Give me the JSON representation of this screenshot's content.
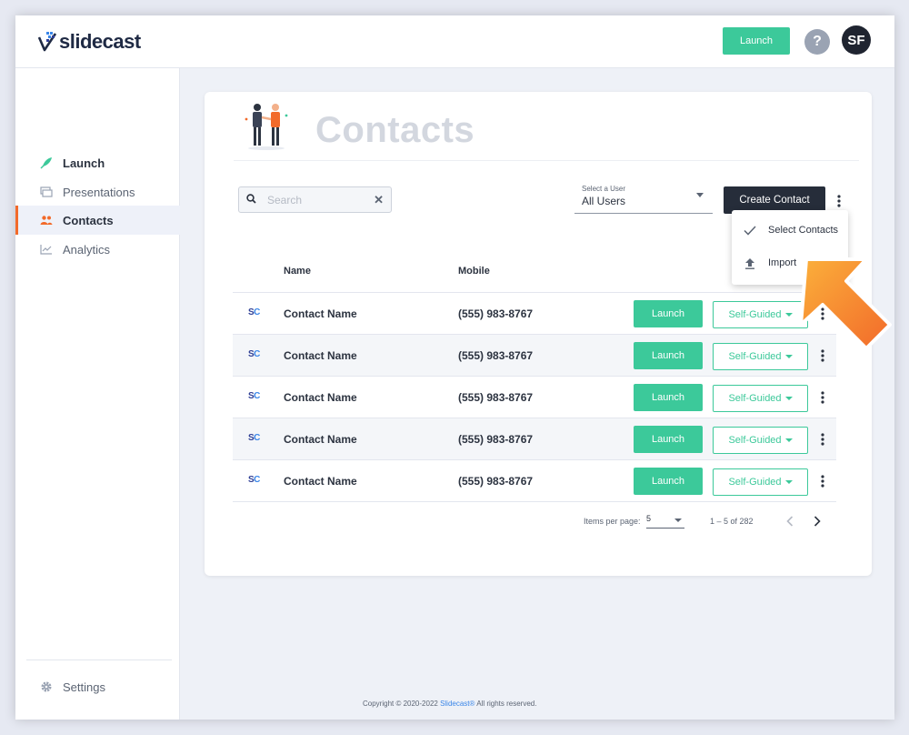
{
  "header": {
    "logo_text": "slidecast",
    "launch_label": "Launch",
    "help_label": "?",
    "avatar_initials": "SF"
  },
  "sidebar": {
    "items": [
      {
        "label": "Launch",
        "icon": "rocket-icon"
      },
      {
        "label": "Presentations",
        "icon": "slides-icon"
      },
      {
        "label": "Contacts",
        "icon": "people-icon"
      },
      {
        "label": "Analytics",
        "icon": "chart-icon"
      }
    ],
    "settings_label": "Settings"
  },
  "page": {
    "title": "Contacts"
  },
  "toolbar": {
    "search_placeholder": "Search",
    "user_select_label": "Select a User",
    "user_select_value": "All Users",
    "create_contact_label": "Create Contact"
  },
  "menu": {
    "items": [
      {
        "label": "Select Contacts",
        "icon": "check-icon"
      },
      {
        "label": "Import",
        "icon": "upload-icon"
      }
    ]
  },
  "table": {
    "columns": [
      "Name",
      "Mobile"
    ],
    "rows": [
      {
        "logo": "SC",
        "name": "Contact Name",
        "mobile": "(555) 983-8767",
        "launch": "Launch",
        "mode": "Self-Guided"
      },
      {
        "logo": "SC",
        "name": "Contact Name",
        "mobile": "(555) 983-8767",
        "launch": "Launch",
        "mode": "Self-Guided"
      },
      {
        "logo": "SC",
        "name": "Contact Name",
        "mobile": "(555) 983-8767",
        "launch": "Launch",
        "mode": "Self-Guided"
      },
      {
        "logo": "SC",
        "name": "Contact Name",
        "mobile": "(555) 983-8767",
        "launch": "Launch",
        "mode": "Self-Guided"
      },
      {
        "logo": "SC",
        "name": "Contact Name",
        "mobile": "(555) 983-8767",
        "launch": "Launch",
        "mode": "Self-Guided"
      }
    ]
  },
  "pagination": {
    "items_per_page_label": "Items per page:",
    "items_per_page_value": "5",
    "range_text": "1 – 5 of 282"
  },
  "footer": {
    "prefix": "Copyright © 2020-2022 ",
    "link": "Slidecast®",
    "suffix": " All rights reserved."
  },
  "colors": {
    "accent_green": "#3cc99a",
    "active_orange": "#f26a2a",
    "dark_button": "#262d3a",
    "callout_arrow": "#f7931e"
  }
}
